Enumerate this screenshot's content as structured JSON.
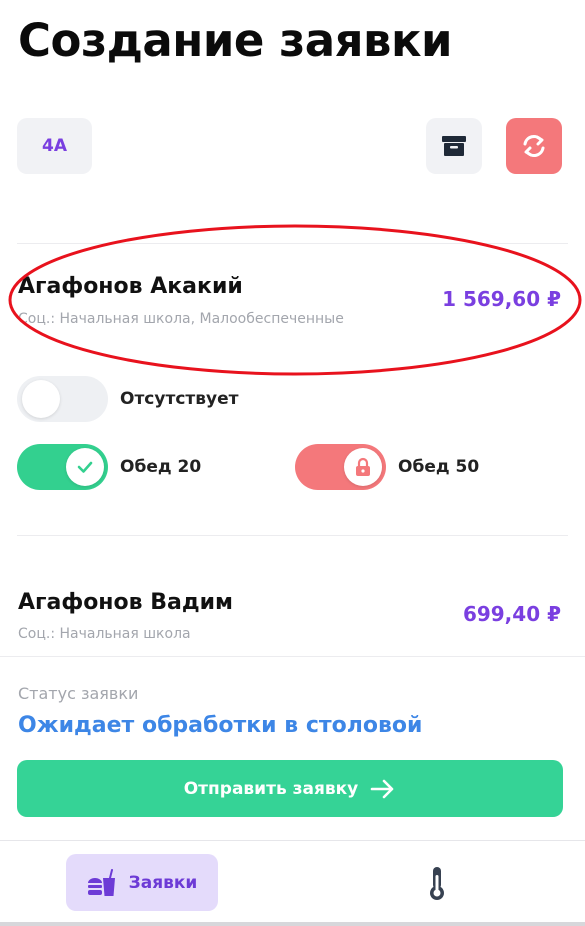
{
  "header": {
    "title": "Создание заявки"
  },
  "toolbar": {
    "class_label": "4А",
    "archive_icon": "archive-box-icon",
    "refresh_icon": "refresh-arrows-icon",
    "refresh_color": "#f4787b"
  },
  "students": [
    {
      "name": "Агафонов Акакий",
      "category": "Соц.: Начальная школа, Малообеспеченные",
      "amount": "1 569,60 ₽",
      "highlighted": true,
      "toggles": [
        {
          "label": "Отсутствует",
          "state": "off"
        },
        {
          "label": "Обед 20",
          "state": "on"
        },
        {
          "label": "Обед 50",
          "state": "locked"
        }
      ]
    },
    {
      "name": "Агафонов Вадим",
      "category": "Соц.: Начальная школа",
      "amount": "699,40 ₽"
    }
  ],
  "status": {
    "label": "Статус заявки",
    "value": "Ожидает обработки в столовой"
  },
  "submit": {
    "label": "Отправить заявку",
    "icon": "arrow-right-icon"
  },
  "bottom_nav": {
    "tabs": [
      {
        "label": "Заявки",
        "icon": "food-drink-icon",
        "active": true
      },
      {
        "label": "",
        "icon": "thermometer-icon",
        "active": false
      }
    ]
  },
  "colors": {
    "accent_purple": "#7a3fe0",
    "green": "#33d08f",
    "status_blue": "#3d86e6",
    "annotation_red": "#e8121d"
  }
}
